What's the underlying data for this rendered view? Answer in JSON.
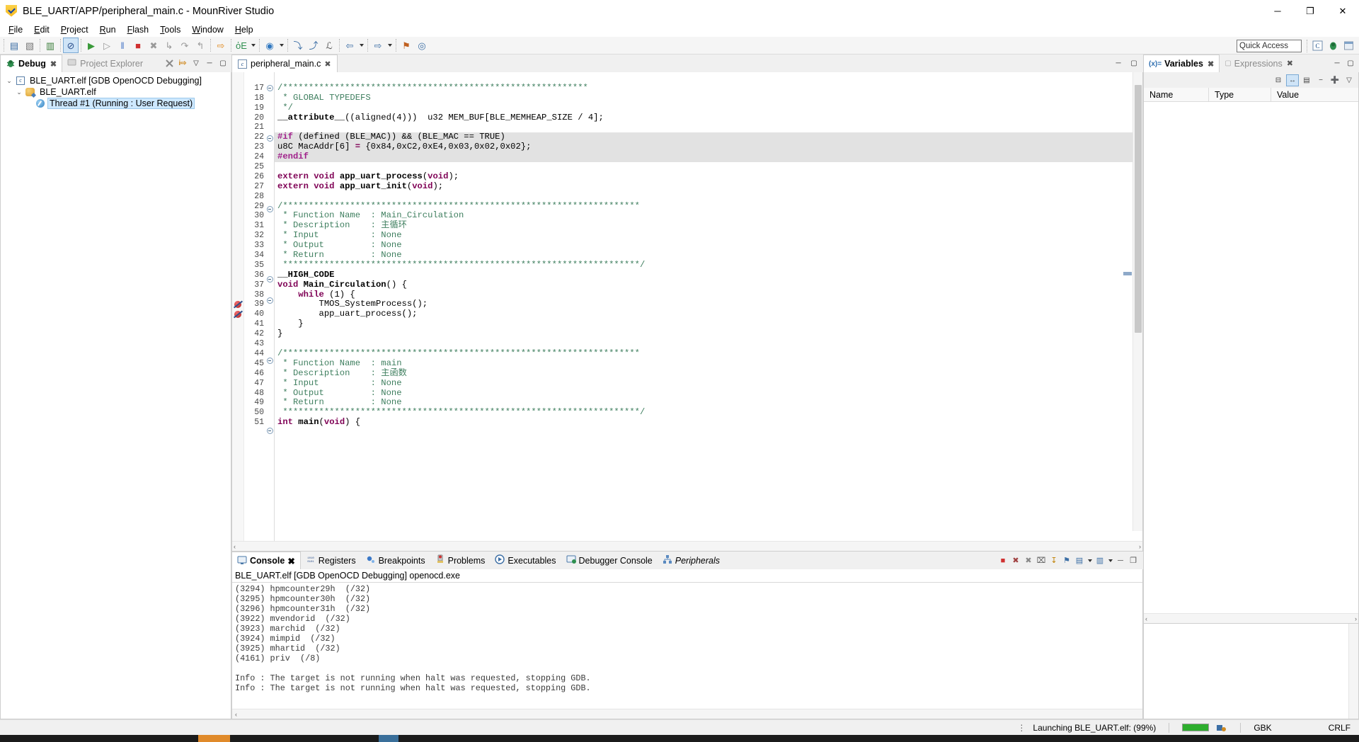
{
  "window": {
    "title": "BLE_UART/APP/peripheral_main.c - MounRiver Studio",
    "app_icon": "mounriver-shield-icon",
    "minimize": "─",
    "maximize": "❐",
    "close": "✕"
  },
  "menu": {
    "items": [
      {
        "label": "File"
      },
      {
        "label": "Edit"
      },
      {
        "label": "Project"
      },
      {
        "label": "Run"
      },
      {
        "label": "Flash"
      },
      {
        "label": "Tools"
      },
      {
        "label": "Window"
      },
      {
        "label": "Help"
      }
    ]
  },
  "toolbar": {
    "quick_access_placeholder": "Quick Access",
    "buttons": [
      {
        "name": "new-wizard-icon",
        "glyph": "▤",
        "color": "#3b6ea5"
      },
      {
        "name": "save-icon",
        "glyph": "▧",
        "color": "#7a7a7a"
      },
      {
        "name": "save-all-icon",
        "glyph": "▥",
        "color": "#3a7d3a"
      },
      {
        "name": "toggle-breakpoint-icon",
        "glyph": "⊘",
        "color": "#2b4f8c",
        "selected": true
      },
      {
        "name": "run-icon",
        "glyph": "▶",
        "color": "#3a9a3a"
      },
      {
        "name": "resume-icon",
        "glyph": "▷",
        "color": "#9a9a9a"
      },
      {
        "name": "suspend-icon",
        "glyph": "‖",
        "color": "#4a78c8"
      },
      {
        "name": "terminate-icon",
        "glyph": "■",
        "color": "#d03030"
      },
      {
        "name": "disconnect-icon",
        "glyph": "✖",
        "color": "#9a9a9a"
      },
      {
        "name": "step-into-icon",
        "glyph": "↳",
        "color": "#9a9a9a"
      },
      {
        "name": "step-over-icon",
        "glyph": "↷",
        "color": "#9a9a9a"
      },
      {
        "name": "step-return-icon",
        "glyph": "↰",
        "color": "#9a9a9a"
      },
      {
        "name": "download-icon",
        "glyph": "⇨",
        "color": "#e08a1e"
      },
      {
        "name": "debug-icon",
        "glyph": "ὁE",
        "color": "#2f8f4f",
        "has_arrow": true
      },
      {
        "name": "run-config-icon",
        "glyph": "◉",
        "color": "#2f77c0",
        "has_arrow": true
      },
      {
        "name": "next-annotation-icon",
        "glyph": "⤵",
        "color": "#3b6ea5"
      },
      {
        "name": "previous-annotation-icon",
        "glyph": "⤴",
        "color": "#3b6ea5"
      },
      {
        "name": "last-edit-icon",
        "glyph": "ℒ",
        "color": "#555"
      },
      {
        "name": "back-icon",
        "glyph": "⇦",
        "color": "#3b6ea5",
        "has_arrow": true
      },
      {
        "name": "forward-icon",
        "glyph": "⇨",
        "color": "#3b6ea5",
        "has_arrow": true
      },
      {
        "name": "pin-icon",
        "glyph": "⚑",
        "color": "#c06020"
      },
      {
        "name": "search-icon",
        "glyph": "◎",
        "color": "#3b6ea5"
      }
    ],
    "right_icons": [
      {
        "name": "perspective-cpp-icon",
        "glyph": "C",
        "color": "#2f6fb0"
      },
      {
        "name": "perspective-debug-icon",
        "glyph": "⚙",
        "color": "#3a8f3a"
      },
      {
        "name": "perspective-open-icon",
        "glyph": "⊞",
        "color": "#777"
      }
    ]
  },
  "debug_view": {
    "tabs": [
      {
        "label": "Debug",
        "active": true,
        "icon": "bug-icon",
        "closeable": true
      },
      {
        "label": "Project Explorer",
        "active": false,
        "icon": "project-explorer-icon",
        "closeable": false
      }
    ],
    "toolbar_icons": [
      {
        "name": "remove-all-terminated-icon",
        "glyph": "✖"
      },
      {
        "name": "step-into-selection-icon",
        "glyph": "i⇒"
      },
      {
        "name": "view-menu-icon",
        "glyph": "▽"
      },
      {
        "name": "minimize-icon",
        "glyph": "─"
      },
      {
        "name": "maximize-icon",
        "glyph": "❐"
      }
    ],
    "tree": [
      {
        "label": "BLE_UART.elf [GDB OpenOCD Debugging]",
        "icon": "launch-config-icon",
        "expanded": true,
        "indent": 0,
        "selected": false
      },
      {
        "label": "BLE_UART.elf",
        "icon": "process-icon",
        "expanded": true,
        "indent": 1,
        "selected": false
      },
      {
        "label": "Thread #1 (Running : User Request)",
        "icon": "thread-icon",
        "expanded": false,
        "indent": 2,
        "selected": true
      }
    ]
  },
  "editor": {
    "tab": {
      "label": "peripheral_main.c",
      "icon": "c-file-icon",
      "close": "✖"
    },
    "tools": [
      {
        "name": "minimize-editor-icon",
        "glyph": "─"
      },
      {
        "name": "maximize-editor-icon",
        "glyph": "❐"
      }
    ],
    "scroll_left_arrow": "‹",
    "scroll_right_arrow": "›",
    "first_visible_line": 17,
    "lines": [
      {
        "n": 16,
        "fold": false,
        "highlight": false,
        "partial": true,
        "tokens": [
          {
            "t": " ",
            "c": "c-plain"
          }
        ]
      },
      {
        "n": 17,
        "fold": true,
        "highlight": false,
        "tokens": [
          {
            "t": "/***********************************************************",
            "c": "c-com"
          }
        ]
      },
      {
        "n": 18,
        "fold": false,
        "highlight": false,
        "tokens": [
          {
            "t": " * GLOBAL TYPEDEFS",
            "c": "c-com"
          }
        ]
      },
      {
        "n": 19,
        "fold": false,
        "highlight": false,
        "tokens": [
          {
            "t": " */",
            "c": "c-com"
          }
        ]
      },
      {
        "n": 20,
        "fold": false,
        "highlight": false,
        "tokens": [
          {
            "t": "__attribute__",
            "c": "c-fn"
          },
          {
            "t": "((aligned(4)))  ",
            "c": "c-plain"
          },
          {
            "t": "u32 MEM_BUF[BLE_MEMHEAP_SIZE / 4];",
            "c": "c-plain"
          }
        ]
      },
      {
        "n": 21,
        "fold": false,
        "highlight": false,
        "tokens": [
          {
            "t": "",
            "c": "c-plain"
          }
        ]
      },
      {
        "n": 22,
        "fold": true,
        "highlight": true,
        "tokens": [
          {
            "t": "#if",
            "c": "c-pre"
          },
          {
            "t": " (defined (BLE_MAC)) && (BLE_MAC == TRUE)",
            "c": "c-plain"
          }
        ]
      },
      {
        "n": 23,
        "fold": false,
        "highlight": true,
        "tokens": [
          {
            "t": "u8C MacAddr[6] ",
            "c": "c-plain"
          },
          {
            "t": "=",
            "c": "c-kw"
          },
          {
            "t": " {0x84,0xC2,0xE4,0x03,0x02,0x02};",
            "c": "c-plain"
          }
        ]
      },
      {
        "n": 24,
        "fold": false,
        "highlight": true,
        "tokens": [
          {
            "t": "#endif",
            "c": "c-pre"
          }
        ]
      },
      {
        "n": 25,
        "fold": false,
        "highlight": false,
        "tokens": [
          {
            "t": "",
            "c": "c-plain"
          }
        ]
      },
      {
        "n": 26,
        "fold": false,
        "highlight": false,
        "tokens": [
          {
            "t": "extern",
            "c": "c-kw"
          },
          {
            "t": " ",
            "c": "c-plain"
          },
          {
            "t": "void",
            "c": "c-kw"
          },
          {
            "t": " ",
            "c": "c-plain"
          },
          {
            "t": "app_uart_process",
            "c": "c-fn"
          },
          {
            "t": "(",
            "c": "c-plain"
          },
          {
            "t": "void",
            "c": "c-kw"
          },
          {
            "t": ");",
            "c": "c-plain"
          }
        ]
      },
      {
        "n": 27,
        "fold": false,
        "highlight": false,
        "tokens": [
          {
            "t": "extern",
            "c": "c-kw"
          },
          {
            "t": " ",
            "c": "c-plain"
          },
          {
            "t": "void",
            "c": "c-kw"
          },
          {
            "t": " ",
            "c": "c-plain"
          },
          {
            "t": "app_uart_init",
            "c": "c-fn"
          },
          {
            "t": "(",
            "c": "c-plain"
          },
          {
            "t": "void",
            "c": "c-kw"
          },
          {
            "t": ");",
            "c": "c-plain"
          }
        ]
      },
      {
        "n": 28,
        "fold": false,
        "highlight": false,
        "tokens": [
          {
            "t": "",
            "c": "c-plain"
          }
        ]
      },
      {
        "n": 29,
        "fold": true,
        "highlight": false,
        "tokens": [
          {
            "t": "/*********************************************************************",
            "c": "c-com"
          }
        ]
      },
      {
        "n": 30,
        "fold": false,
        "highlight": false,
        "tokens": [
          {
            "t": " * Function Name  : Main_Circulation",
            "c": "c-com"
          }
        ]
      },
      {
        "n": 31,
        "fold": false,
        "highlight": false,
        "tokens": [
          {
            "t": " * Description    : 主循环",
            "c": "c-com"
          }
        ]
      },
      {
        "n": 32,
        "fold": false,
        "highlight": false,
        "tokens": [
          {
            "t": " * Input          : None",
            "c": "c-com"
          }
        ]
      },
      {
        "n": 33,
        "fold": false,
        "highlight": false,
        "tokens": [
          {
            "t": " * Output         : None",
            "c": "c-com"
          }
        ]
      },
      {
        "n": 34,
        "fold": false,
        "highlight": false,
        "tokens": [
          {
            "t": " * Return         : None",
            "c": "c-com"
          }
        ]
      },
      {
        "n": 35,
        "fold": false,
        "highlight": false,
        "tokens": [
          {
            "t": " *********************************************************************/",
            "c": "c-com"
          }
        ]
      },
      {
        "n": 36,
        "fold": true,
        "highlight": false,
        "tokens": [
          {
            "t": "__HIGH_CODE",
            "c": "c-fn"
          }
        ]
      },
      {
        "n": 37,
        "fold": false,
        "highlight": false,
        "tokens": [
          {
            "t": "void",
            "c": "c-kw"
          },
          {
            "t": " ",
            "c": "c-plain"
          },
          {
            "t": "Main_Circulation",
            "c": "c-fn"
          },
          {
            "t": "() {",
            "c": "c-plain"
          }
        ]
      },
      {
        "n": 38,
        "fold": true,
        "highlight": false,
        "tokens": [
          {
            "t": "    ",
            "c": "c-plain"
          },
          {
            "t": "while",
            "c": "c-kw"
          },
          {
            "t": " (1) {",
            "c": "c-plain"
          }
        ]
      },
      {
        "n": 39,
        "fold": false,
        "highlight": false,
        "breakpoint": true,
        "tokens": [
          {
            "t": "        TMOS_SystemProcess();",
            "c": "c-plain"
          }
        ]
      },
      {
        "n": 40,
        "fold": false,
        "highlight": false,
        "breakpoint": true,
        "tokens": [
          {
            "t": "        app_uart_process();",
            "c": "c-plain"
          }
        ]
      },
      {
        "n": 41,
        "fold": false,
        "highlight": false,
        "tokens": [
          {
            "t": "    }",
            "c": "c-plain"
          }
        ]
      },
      {
        "n": 42,
        "fold": false,
        "highlight": false,
        "tokens": [
          {
            "t": "}",
            "c": "c-plain"
          }
        ]
      },
      {
        "n": 43,
        "fold": false,
        "highlight": false,
        "tokens": [
          {
            "t": "",
            "c": "c-plain"
          }
        ]
      },
      {
        "n": 44,
        "fold": true,
        "highlight": false,
        "tokens": [
          {
            "t": "/*********************************************************************",
            "c": "c-com"
          }
        ]
      },
      {
        "n": 45,
        "fold": false,
        "highlight": false,
        "tokens": [
          {
            "t": " * Function Name  : main",
            "c": "c-com"
          }
        ]
      },
      {
        "n": 46,
        "fold": false,
        "highlight": false,
        "tokens": [
          {
            "t": " * Description    : 主函数",
            "c": "c-com"
          }
        ]
      },
      {
        "n": 47,
        "fold": false,
        "highlight": false,
        "tokens": [
          {
            "t": " * Input          : None",
            "c": "c-com"
          }
        ]
      },
      {
        "n": 48,
        "fold": false,
        "highlight": false,
        "tokens": [
          {
            "t": " * Output         : None",
            "c": "c-com"
          }
        ]
      },
      {
        "n": 49,
        "fold": false,
        "highlight": false,
        "tokens": [
          {
            "t": " * Return         : None",
            "c": "c-com"
          }
        ]
      },
      {
        "n": 50,
        "fold": false,
        "highlight": false,
        "tokens": [
          {
            "t": " *********************************************************************/",
            "c": "c-com"
          }
        ]
      },
      {
        "n": 51,
        "fold": true,
        "highlight": false,
        "tokens": [
          {
            "t": "int",
            "c": "c-kw"
          },
          {
            "t": " ",
            "c": "c-plain"
          },
          {
            "t": "main",
            "c": "c-fn"
          },
          {
            "t": "(",
            "c": "c-plain"
          },
          {
            "t": "void",
            "c": "c-kw"
          },
          {
            "t": ") {",
            "c": "c-plain"
          }
        ]
      }
    ]
  },
  "variables_view": {
    "tabs": [
      {
        "label": "Variables",
        "active": true,
        "icon": "variables-icon",
        "closeable": true
      },
      {
        "label": "Expressions",
        "active": false,
        "icon": "expressions-icon",
        "closeable": true
      }
    ],
    "window_icons": [
      {
        "name": "minimize-icon",
        "glyph": "─"
      },
      {
        "name": "maximize-icon",
        "glyph": "❐"
      }
    ],
    "toolbar_icons": [
      {
        "name": "collapse-all-icon",
        "glyph": "⊟"
      },
      {
        "name": "show-type-names-icon",
        "glyph": "↔",
        "active": true
      },
      {
        "name": "show-logical-structure-icon",
        "glyph": "▤"
      },
      {
        "name": "collapse-icon",
        "glyph": "−"
      },
      {
        "name": "new-expression-icon",
        "glyph": "➕"
      },
      {
        "name": "view-menu-icon",
        "glyph": "▽"
      }
    ],
    "columns": [
      "Name",
      "Type",
      "Value"
    ],
    "rows": []
  },
  "console_view": {
    "tabs": [
      {
        "label": "Console",
        "active": true,
        "icon": "console-icon",
        "closeable": true,
        "italic": false
      },
      {
        "label": "Registers",
        "active": false,
        "icon": "registers-icon",
        "closeable": false,
        "italic": false
      },
      {
        "label": "Breakpoints",
        "active": false,
        "icon": "breakpoints-icon",
        "closeable": false,
        "italic": false
      },
      {
        "label": "Problems",
        "active": false,
        "icon": "problems-icon",
        "closeable": false,
        "italic": false
      },
      {
        "label": "Executables",
        "active": false,
        "icon": "executables-icon",
        "closeable": false,
        "italic": false
      },
      {
        "label": "Debugger Console",
        "active": false,
        "icon": "debugger-console-icon",
        "closeable": false,
        "italic": false
      },
      {
        "label": "Peripherals",
        "active": false,
        "icon": "peripherals-icon",
        "closeable": false,
        "italic": true
      }
    ],
    "toolbar_icons": [
      {
        "name": "terminate-icon",
        "glyph": "■",
        "color": "#d03030"
      },
      {
        "name": "remove-launch-icon",
        "glyph": "✖",
        "color": "#a04040"
      },
      {
        "name": "remove-all-launches-icon",
        "glyph": "✖",
        "color": "#888"
      },
      {
        "name": "clear-console-icon",
        "glyph": "⌧",
        "color": "#555"
      },
      {
        "name": "scroll-lock-icon",
        "glyph": "↧",
        "color": "#c08000"
      },
      {
        "name": "pin-console-icon",
        "glyph": "⚑",
        "color": "#3b6ea5"
      },
      {
        "name": "display-selected-console-icon",
        "glyph": "▤",
        "color": "#3b6ea5",
        "has_arrow": true
      },
      {
        "name": "open-console-icon",
        "glyph": "▥",
        "color": "#3b6ea5",
        "has_arrow": true
      },
      {
        "name": "minimize-icon",
        "glyph": "─",
        "color": "#555"
      },
      {
        "name": "maximize-icon",
        "glyph": "❐",
        "color": "#555"
      }
    ],
    "header": "BLE_UART.elf [GDB OpenOCD Debugging] openocd.exe",
    "log": "(3294) hpmcounter29h  (/32)\n(3295) hpmcounter30h  (/32)\n(3296) hpmcounter31h  (/32)\n(3922) mvendorid  (/32)\n(3923) marchid  (/32)\n(3924) mimpid  (/32)\n(3925) mhartid  (/32)\n(4161) priv  (/8)\n\nInfo : The target is not running when halt was requested, stopping GDB.\nInfo : The target is not running when halt was requested, stopping GDB."
  },
  "status_bar": {
    "launching_text": "Launching BLE_UART.elf: (99%)",
    "progress_percent": 99,
    "encoding": "GBK",
    "line_ending": "CRLF",
    "icons": [
      {
        "name": "progress-bar",
        "glyph": ""
      },
      {
        "name": "build-indicator-icon",
        "glyph": "■",
        "color": "#2eae2e"
      },
      {
        "name": "network-icon",
        "glyph": "▣",
        "color": "#3b6ea5"
      }
    ]
  },
  "colors": {
    "accent": "#cde8ff",
    "selection": "#cde8ff",
    "comment": "#3f7f5f",
    "keyword": "#7f0055",
    "preprocessor": "#a0208a",
    "highlight_row": "#e2e2e2",
    "progress_green": "#2eae2e",
    "breakpoint_red": "#b32020"
  }
}
